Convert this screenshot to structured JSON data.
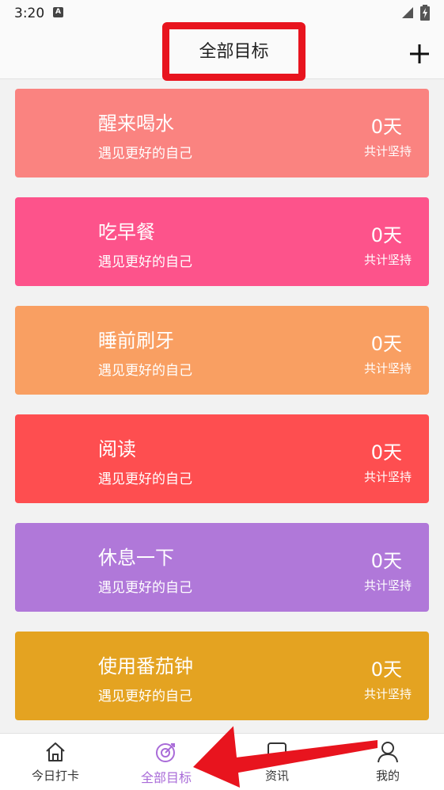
{
  "status_bar": {
    "time": "3:20",
    "indicator": "A"
  },
  "header": {
    "title": "全部目标",
    "add_icon": "plus-icon"
  },
  "goals": [
    {
      "name": "醒来喝水",
      "subtitle": "遇见更好的自己",
      "days": "0天",
      "total_label": "共计坚持",
      "color": "#fa8380"
    },
    {
      "name": "吃早餐",
      "subtitle": "遇见更好的自己",
      "days": "0天",
      "total_label": "共计坚持",
      "color": "#fd538b"
    },
    {
      "name": "睡前刷牙",
      "subtitle": "遇见更好的自己",
      "days": "0天",
      "total_label": "共计坚持",
      "color": "#f99f62"
    },
    {
      "name": "阅读",
      "subtitle": "遇见更好的自己",
      "days": "0天",
      "total_label": "共计坚持",
      "color": "#fe4e50"
    },
    {
      "name": "休息一下",
      "subtitle": "遇见更好的自己",
      "days": "0天",
      "total_label": "共计坚持",
      "color": "#b078d9"
    },
    {
      "name": "使用番茄钟",
      "subtitle": "遇见更好的自己",
      "days": "0天",
      "total_label": "共计坚持",
      "color": "#e4a321"
    }
  ],
  "tabbar": {
    "tabs": [
      {
        "label": "今日打卡",
        "icon": "home-icon",
        "active": false
      },
      {
        "label": "全部目标",
        "icon": "target-icon",
        "active": true
      },
      {
        "label": "资讯",
        "icon": "news-icon",
        "active": false
      },
      {
        "label": "我的",
        "icon": "user-icon",
        "active": false
      }
    ]
  },
  "colors": {
    "accent": "#a96bd8",
    "highlight": "#e8141e"
  }
}
